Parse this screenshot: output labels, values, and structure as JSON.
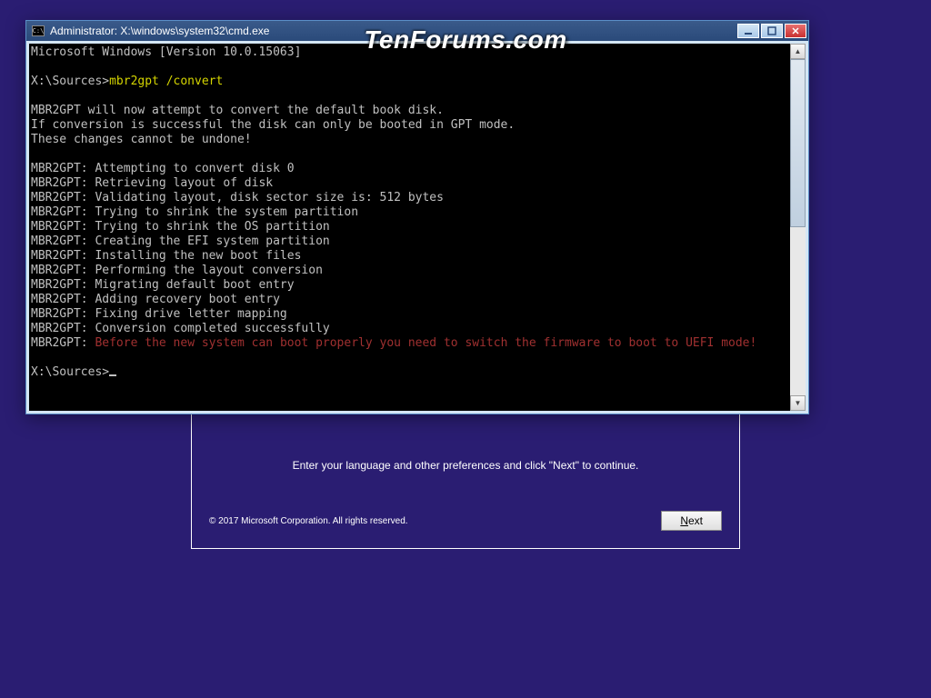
{
  "watermark": "TenForums.com",
  "setup": {
    "instruction": "Enter your language and other preferences and click \"Next\" to continue.",
    "copyright": "© 2017 Microsoft Corporation. All rights reserved.",
    "next_label": "Next"
  },
  "cmd": {
    "title": "Administrator: X:\\windows\\system32\\cmd.exe",
    "version_line": "Microsoft Windows [Version 10.0.15063]",
    "prompt1_path": "X:\\Sources>",
    "prompt1_cmd": "mbr2gpt /convert",
    "out1": "MBR2GPT will now attempt to convert the default book disk.",
    "out2": "If conversion is successful the disk can only be booted in GPT mode.",
    "out3": "These changes cannot be undone!",
    "out4": "MBR2GPT: Attempting to convert disk 0",
    "out5": "MBR2GPT: Retrieving layout of disk",
    "out6": "MBR2GPT: Validating layout, disk sector size is: 512 bytes",
    "out7": "MBR2GPT: Trying to shrink the system partition",
    "out8": "MBR2GPT: Trying to shrink the OS partition",
    "out9": "MBR2GPT: Creating the EFI system partition",
    "out10": "MBR2GPT: Installing the new boot files",
    "out11": "MBR2GPT: Performing the layout conversion",
    "out12": "MBR2GPT: Migrating default boot entry",
    "out13": "MBR2GPT: Adding recovery boot entry",
    "out14": "MBR2GPT: Fixing drive letter mapping",
    "out15": "MBR2GPT: Conversion completed successfully",
    "out16_prefix": "MBR2GPT: ",
    "out16_msg": "Before the new system can boot properly you need to switch the firmware to boot to UEFI mode!",
    "prompt2_path": "X:\\Sources>"
  }
}
